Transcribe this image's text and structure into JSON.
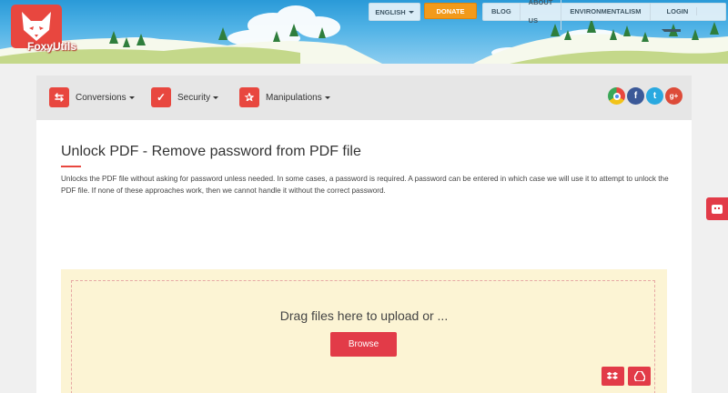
{
  "header": {
    "logo_text": "FoxyUtils",
    "language_label": "ENGLISH",
    "donate_label": "DONATE",
    "nav": [
      "BLOG",
      "ABOUT US",
      "ENVIRONMENTALISM"
    ],
    "login_label": "LOGIN"
  },
  "toolbar": {
    "items": [
      {
        "label": "Conversions",
        "icon": "convert-arrows-icon"
      },
      {
        "label": "Security",
        "icon": "shield-check-icon"
      },
      {
        "label": "Manipulations",
        "icon": "pdf-icon"
      }
    ],
    "social": [
      {
        "name": "chrome-icon",
        "color": "#f2c318"
      },
      {
        "name": "facebook-icon",
        "color": "#3b5998"
      },
      {
        "name": "twitter-icon",
        "color": "#2aa9e0"
      },
      {
        "name": "google-plus-icon",
        "color": "#dd4b39"
      }
    ]
  },
  "main": {
    "title": "Unlock PDF - Remove password from PDF file",
    "description": "Unlocks the PDF file without asking for password unless needed. In some cases, a password is required. A password can be entered in which case we will use it to attempt to unlock the PDF file. If none of these approaches work, then we cannot handle it without the correct password."
  },
  "upload": {
    "prompt": "Drag files here to upload or ...",
    "browse_label": "Browse",
    "sources": [
      "dropbox-icon",
      "google-drive-icon"
    ]
  },
  "colors": {
    "accent": "#e8473f",
    "donate": "#f29a1b",
    "dropzone_bg": "#fcf4d4"
  }
}
